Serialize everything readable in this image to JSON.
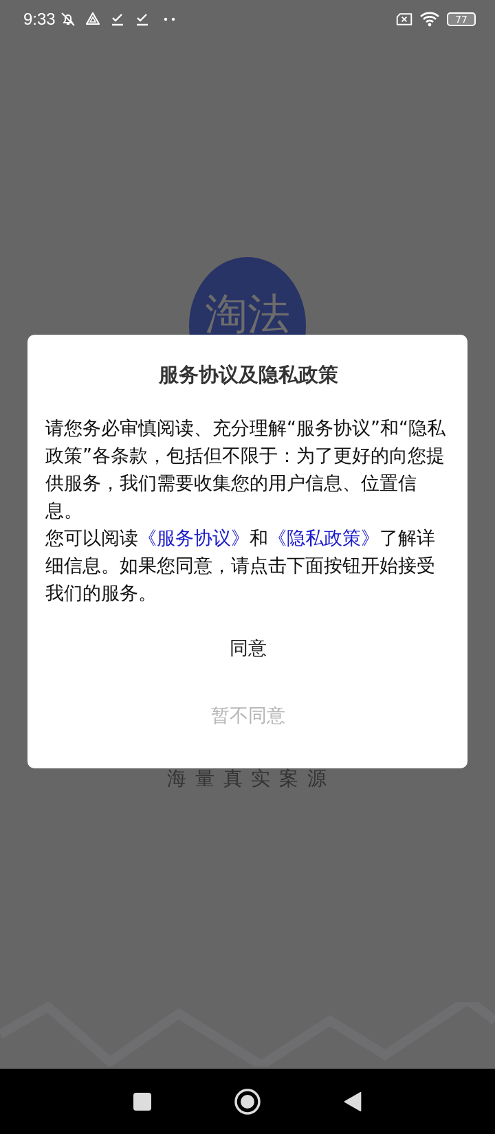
{
  "status_bar": {
    "time": "9:33",
    "battery": "77"
  },
  "logo": {
    "text": "淘法"
  },
  "slogan": "海 量 真 实 案 源",
  "dialog": {
    "title": "服务协议及隐私政策",
    "paragraphs": [
      [
        {
          "kind": "text",
          "text": "请您务必审慎阅读、充分理解“服务协议”和“隐私政策”各条款，包括但不限于：为了更好的向您提供服务，我们需要收集您的用户信息、位置信息。"
        }
      ],
      [
        {
          "kind": "text",
          "text": "您可以阅读"
        },
        {
          "kind": "link",
          "text": "《服务协议》"
        },
        {
          "kind": "text",
          "text": "和"
        },
        {
          "kind": "link",
          "text": "《隐私政策》"
        },
        {
          "kind": "text",
          "text": "了解详细信息。如果您同意，请点击下面按钮开始接受我们的服务。"
        }
      ]
    ],
    "buttons": [
      {
        "label": "同意",
        "kind": "primary"
      },
      {
        "label": "暂不同意",
        "kind": "secondary"
      }
    ]
  }
}
